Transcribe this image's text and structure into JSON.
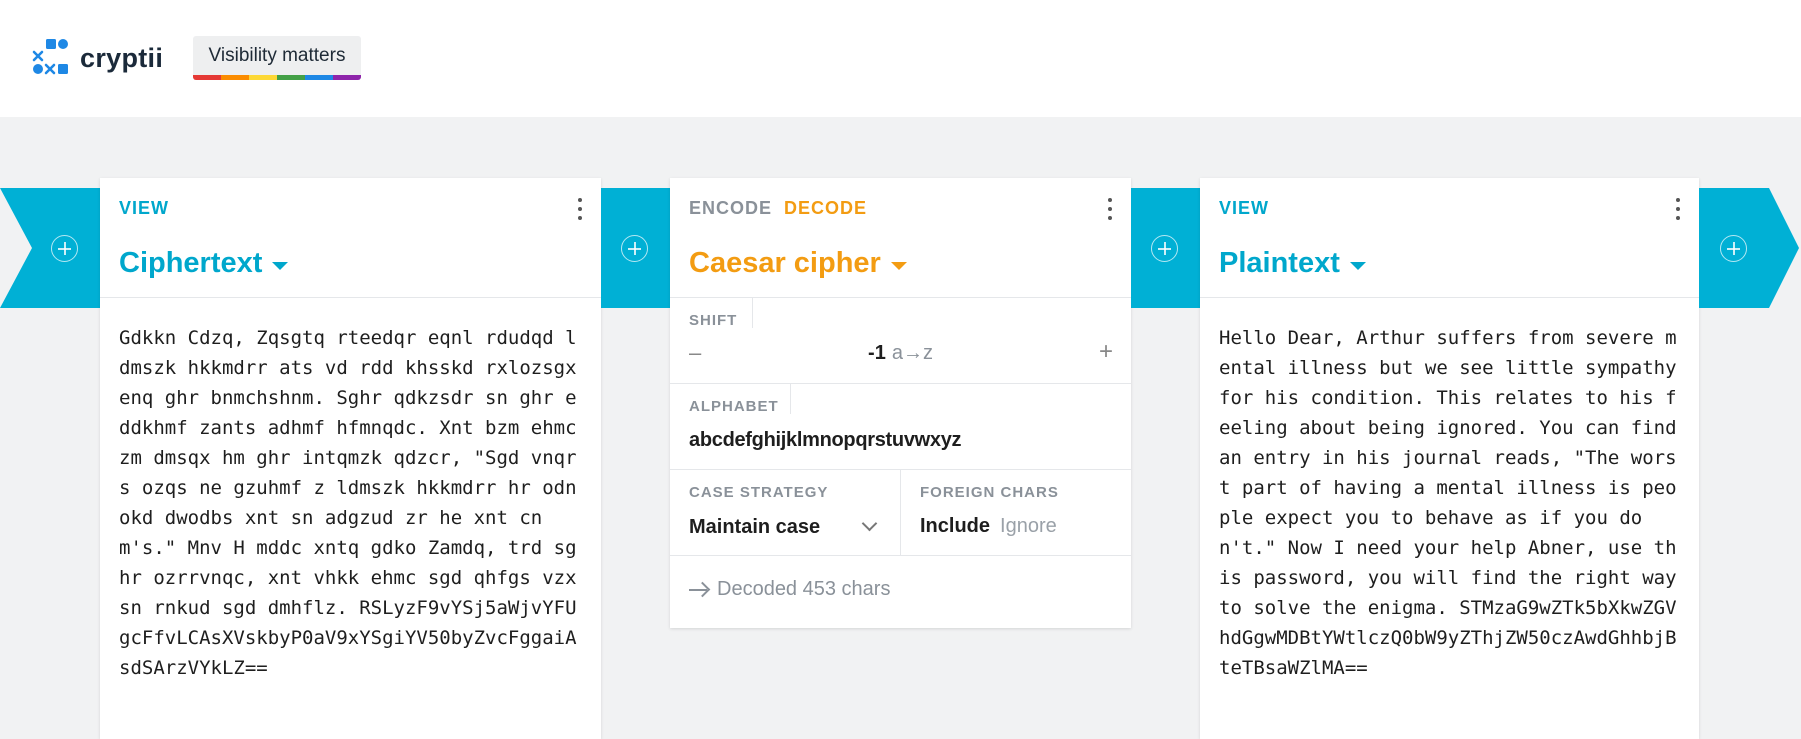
{
  "header": {
    "logo_text": "cryptii",
    "badge_label": "Visibility matters",
    "badge_colors": [
      "#e53935",
      "#fb8c00",
      "#fdd835",
      "#43a047",
      "#1e88e5",
      "#8e24aa"
    ]
  },
  "bricks": [
    {
      "mode_label": "VIEW",
      "title": "Ciphertext",
      "content": "Gdkkn Cdzq, Zqsgtq rteedqr eqnl rdudqd ldmszk hkkmdrr ats vd rdd khsskd rxlozsgx enq ghr bnmchshnm. Sghr qdkzsdr sn ghr eddkhmf zants adhmf hfmnqdc. Xnt bzm ehmc zm dmsqx hm ghr intqmzk qdzcr, \"Sgd vnqrs ozqs ne gzuhmf z ldmszk hkkmdrr hr odnokd dwodbs xnt sn adgzud zr he xnt cnm's.\" Mnv H mddc xntq gdko Zamdq, trd sghr ozrrvnqc, xnt vhkk ehmc sgd qhfgs vzx sn rnkud sgd dmhflz. RSLyzF9vYSj5aWjvYFUgcFfvLCAsXVskbyP0aV9xYSgiYV50byZvcFggaiAsdSArzVYkLZ=="
    },
    {
      "mode_encode": "ENCODE",
      "mode_decode": "DECODE",
      "title": "Caesar cipher",
      "shift_label": "SHIFT",
      "shift_minus": "–",
      "shift_value": "-1",
      "shift_range": "a→z",
      "shift_plus": "+",
      "alphabet_label": "ALPHABET",
      "alphabet_value": "abcdefghijklmnopqrstuvwxyz",
      "case_label": "CASE STRATEGY",
      "case_value": "Maintain case",
      "foreign_label": "FOREIGN CHARS",
      "foreign_include": "Include",
      "foreign_ignore": "Ignore",
      "status": "Decoded 453 chars"
    },
    {
      "mode_label": "VIEW",
      "title": "Plaintext",
      "content": "Hello Dear, Arthur suffers from severe mental illness but we see little sympathy for his condition. This relates to his feeling about being ignored. You can find an entry in his journal reads, \"The worst part of having a mental illness is people expect you to behave as if you don't.\" Now I need your help Abner, use this password, you will find the right way to solve the enigma. STMzaG9wZTk5bXkwZGVhdGgwMDBtYWtlczQ0bW9yZThjZW50czAwdGhhbjBteTBsaWZlMA=="
    }
  ]
}
